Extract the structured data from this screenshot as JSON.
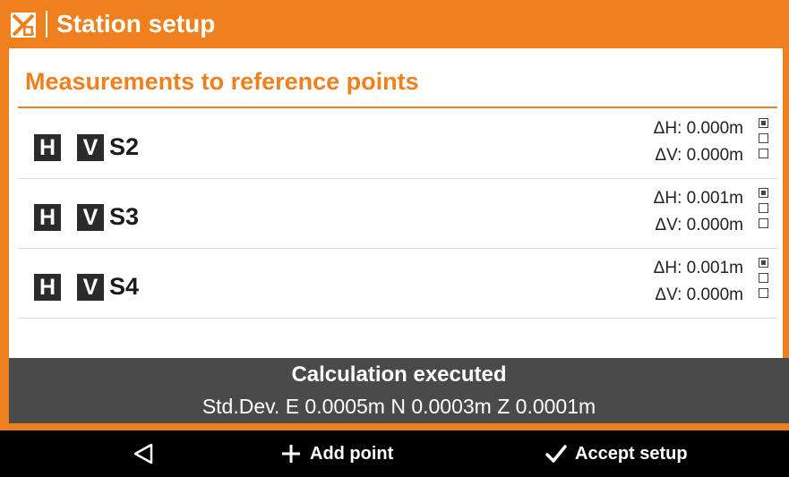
{
  "window": {
    "title": "Station setup",
    "accent_color": "#f07f1e"
  },
  "section": {
    "title": "Measurements to reference points"
  },
  "points": [
    {
      "h_badge": "H",
      "v_badge": "V",
      "name": "S2",
      "dh": "ΔH: 0.000m",
      "dv": "ΔV: 0.000m",
      "check1": true,
      "check2": false,
      "check3": false
    },
    {
      "h_badge": "H",
      "v_badge": "V",
      "name": "S3",
      "dh": "ΔH: 0.001m",
      "dv": "ΔV: 0.000m",
      "check1": true,
      "check2": false,
      "check3": false
    },
    {
      "h_badge": "H",
      "v_badge": "V",
      "name": "S4",
      "dh": "ΔH: 0.001m",
      "dv": "ΔV: 0.000m",
      "check1": true,
      "check2": false,
      "check3": false
    }
  ],
  "status": {
    "title": "Calculation executed",
    "detail": "Std.Dev. E 0.0005m N 0.0003m Z 0.0001m"
  },
  "toolbar": {
    "back_icon": "back-triangle-icon",
    "add_label": "Add point",
    "add_icon": "plus-icon",
    "accept_label": "Accept setup",
    "accept_icon": "checkmark-icon"
  }
}
